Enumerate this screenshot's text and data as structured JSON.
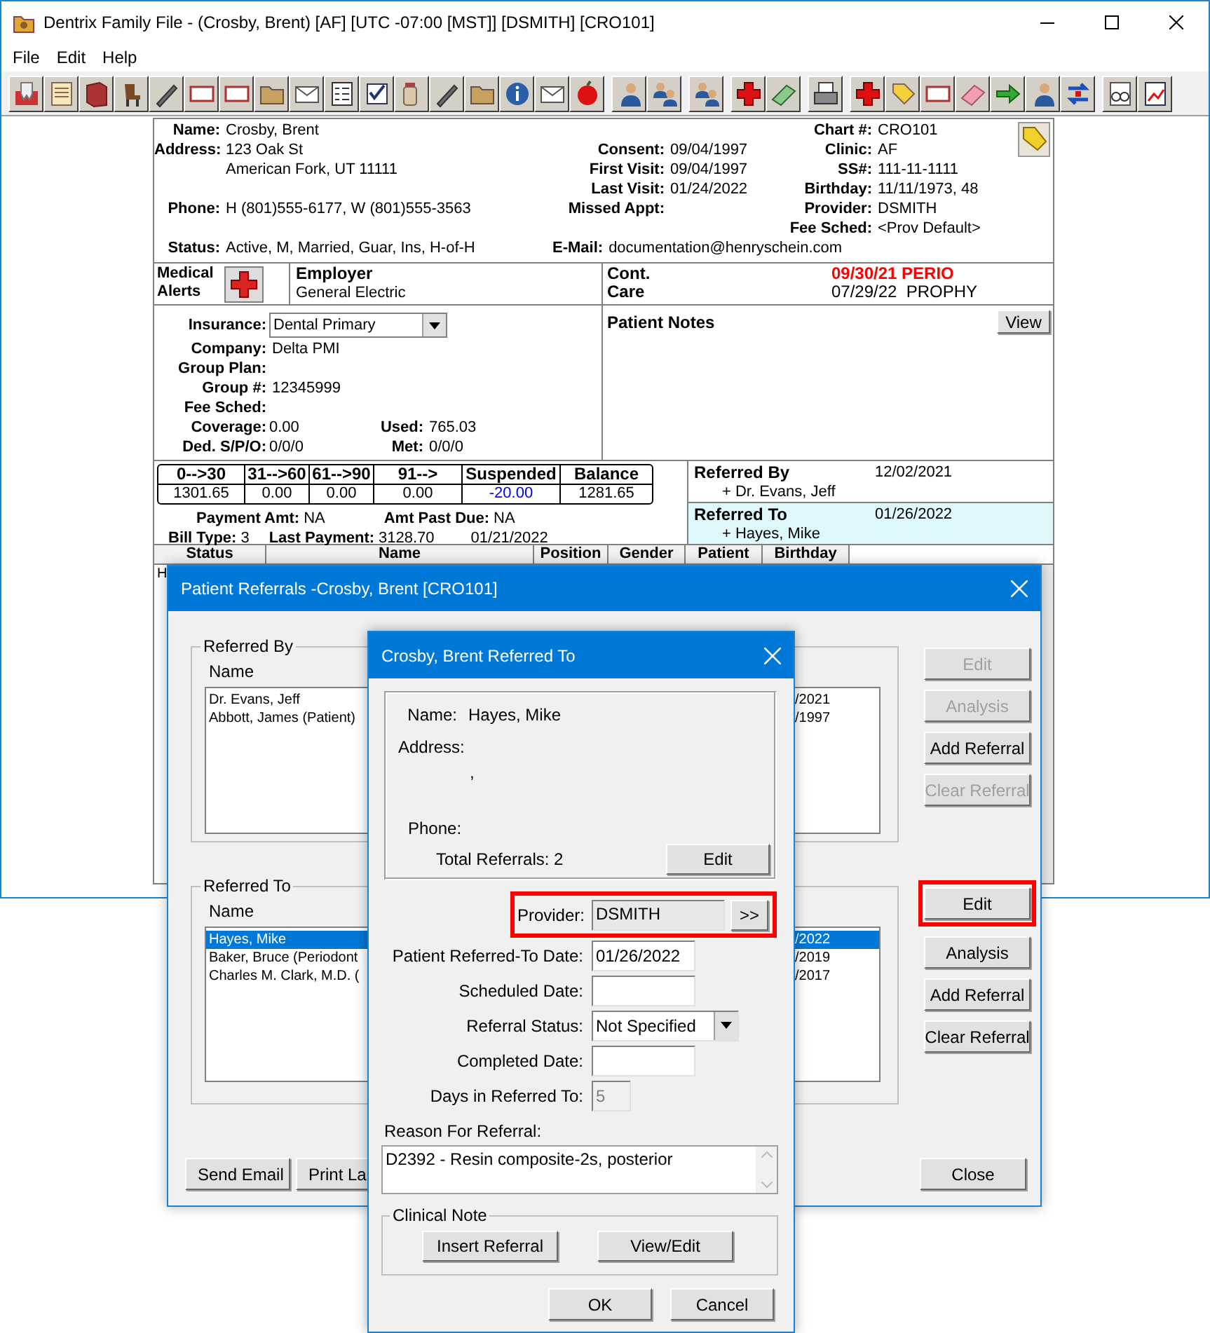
{
  "main_window": {
    "title": "Dentrix Family File - (Crosby, Brent) [AF] [UTC -07:00 [MST]] [DSMITH] [CRO101]",
    "menu": [
      "File",
      "Edit",
      "Help"
    ],
    "patient": {
      "left_fields": [
        {
          "label": "Name:",
          "value": "Crosby, Brent"
        },
        {
          "label": "Address:",
          "value": "123 Oak St"
        },
        {
          "value": "American Fork, UT  11111"
        },
        {
          "label": "Phone:",
          "value": "H (801)555-6177, W (801)555-3563"
        },
        {
          "label": "Status:",
          "value": "Active, M, Married, Guar, Ins, H-of-H"
        }
      ],
      "middle_fields": [
        {
          "label": "Consent:",
          "value": "09/04/1997"
        },
        {
          "label": "First Visit:",
          "value": "09/04/1997"
        },
        {
          "label": "Last Visit:",
          "value": "01/24/2022"
        },
        {
          "label": "Missed Appt:"
        },
        {
          "label": "E-Mail:",
          "value": "documentation@henryschein.com"
        }
      ],
      "right_fields": [
        {
          "label": "Chart #:",
          "value": "CRO101"
        },
        {
          "label": "Clinic:",
          "value": "AF"
        },
        {
          "label": "SS#:",
          "value": "111-11-1111"
        },
        {
          "label": "Birthday:",
          "value": "11/11/1973, 48"
        },
        {
          "label": "Provider:",
          "value": "DSMITH"
        },
        {
          "label": "Fee Sched:",
          "value": "<Prov Default>"
        }
      ],
      "medical_alerts": {
        "label": "Medical Alerts"
      },
      "employer": {
        "label": "Employer",
        "value": "General Electric"
      },
      "continuing_care": {
        "label": "Cont. Care",
        "entries": [
          {
            "text": "09/30/21 PERIO",
            "overdue": true
          },
          {
            "text": "07/29/22  PROPHY",
            "overdue": false
          }
        ]
      },
      "insurance": {
        "label": "Insurance:",
        "value": "Dental Primary",
        "fields": [
          {
            "label": "Company:",
            "value": "Delta PMI"
          },
          {
            "label": "Group Plan:"
          },
          {
            "label": "Group #:",
            "value": "12345999"
          },
          {
            "label": "Fee Sched:"
          }
        ],
        "pairs": [
          [
            {
              "label": "Coverage:",
              "value": "0.00"
            },
            {
              "label": "Used:",
              "value": "765.03"
            }
          ],
          [
            {
              "label": "Ded. S/P/O:",
              "value": "0/0/0"
            },
            {
              "label": "Met:",
              "value": "0/0/0"
            }
          ]
        ]
      },
      "patient_notes": {
        "label": "Patient Notes",
        "button": "View"
      },
      "aging": {
        "columns": [
          "0-->30",
          "31-->60",
          "61-->90",
          "91-->",
          "Suspended",
          "Balance"
        ],
        "values": [
          {
            "text": "1301.65",
            "credit": false
          },
          {
            "text": "0.00",
            "credit": false
          },
          {
            "text": "0.00",
            "credit": false
          },
          {
            "text": "0.00",
            "credit": false
          },
          {
            "text": "-20.00",
            "credit": true
          },
          {
            "text": "1281.65",
            "credit": false
          }
        ]
      },
      "payment": [
        {
          "label": "Payment Amt:",
          "value": "NA",
          "label2": "Amt Past Due:",
          "value2": "NA"
        },
        {
          "label": "Bill Type:",
          "value": "3",
          "label2": "Last Payment:",
          "value2": "3128.70",
          "date": "01/21/2022"
        }
      ],
      "referrals": [
        {
          "label": "Referred By",
          "date": "12/02/2021",
          "name": "+ Dr. Evans, Jeff",
          "selected": false
        },
        {
          "label": "Referred To",
          "date": "01/26/2022",
          "name": "+ Hayes, Mike",
          "selected": true
        }
      ],
      "family_table": {
        "columns": [
          "Status",
          "Name",
          "Position",
          "Gender",
          "Patient",
          "Birthday"
        ],
        "first_cell": "H"
      }
    }
  },
  "referrals_dialog": {
    "title": "Patient Referrals -Crosby, Brent [CRO101]",
    "groups": [
      {
        "label": "Referred By",
        "column": "Name",
        "rows": [
          {
            "name": "Dr. Evans, Jeff",
            "date": "/2021",
            "selected": false
          },
          {
            "name": "Abbott, James (Patient)",
            "date": "/1997",
            "selected": false
          }
        ],
        "buttons": [
          {
            "label": "Edit",
            "disabled": true,
            "highlighted": false
          },
          {
            "label": "Analysis",
            "disabled": true,
            "highlighted": false
          },
          {
            "label": "Add Referral",
            "disabled": false,
            "highlighted": false
          },
          {
            "label": "Clear Referral",
            "disabled": true,
            "highlighted": false
          }
        ]
      },
      {
        "label": "Referred To",
        "column": "Name",
        "rows": [
          {
            "name": "Hayes, Mike",
            "date": "/2022",
            "selected": true
          },
          {
            "name": "Baker, Bruce (Periodont",
            "date": "/2019",
            "selected": false
          },
          {
            "name": "Charles M. Clark, M.D. (",
            "date": "/2017",
            "selected": false
          }
        ],
        "buttons": [
          {
            "label": "Edit",
            "disabled": false,
            "highlighted": true
          },
          {
            "label": "Analysis",
            "disabled": false,
            "highlighted": false
          },
          {
            "label": "Add Referral",
            "disabled": false,
            "highlighted": false
          },
          {
            "label": "Clear Referral",
            "disabled": false,
            "highlighted": false
          }
        ]
      }
    ],
    "footer_buttons": [
      "Send Email",
      "Print La"
    ],
    "close_button": "Close"
  },
  "referred_to_dialog": {
    "title": "Crosby, Brent Referred To",
    "name_label": "Name:",
    "name": "Hayes, Mike",
    "address_label": "Address:",
    "address_line": ",",
    "phone_label": "Phone:",
    "total_label": "Total Referrals:",
    "total": "2",
    "edit_button": "Edit",
    "provider": {
      "label": "Provider:",
      "value": "DSMITH",
      "button": ">>",
      "highlighted": true
    },
    "fields": [
      {
        "kind": "input",
        "label": "Patient Referred-To Date:",
        "value": "01/26/2022",
        "disabled": false
      },
      {
        "kind": "input",
        "label": "Scheduled Date:",
        "disabled": false
      },
      {
        "kind": "select",
        "label": "Referral Status:",
        "value": "Not Specified",
        "disabled": false
      },
      {
        "kind": "input",
        "label": "Completed Date:",
        "disabled": false
      },
      {
        "kind": "input",
        "label": "Days in Referred To:",
        "value": "5",
        "disabled": true
      }
    ],
    "reason": {
      "label": "Reason For Referral:",
      "value": "D2392 - Resin composite-2s, posterior"
    },
    "clinical_note": {
      "label": "Clinical Note",
      "buttons": [
        "Insert Referral",
        "View/Edit"
      ]
    },
    "buttons": [
      "OK",
      "Cancel"
    ]
  }
}
